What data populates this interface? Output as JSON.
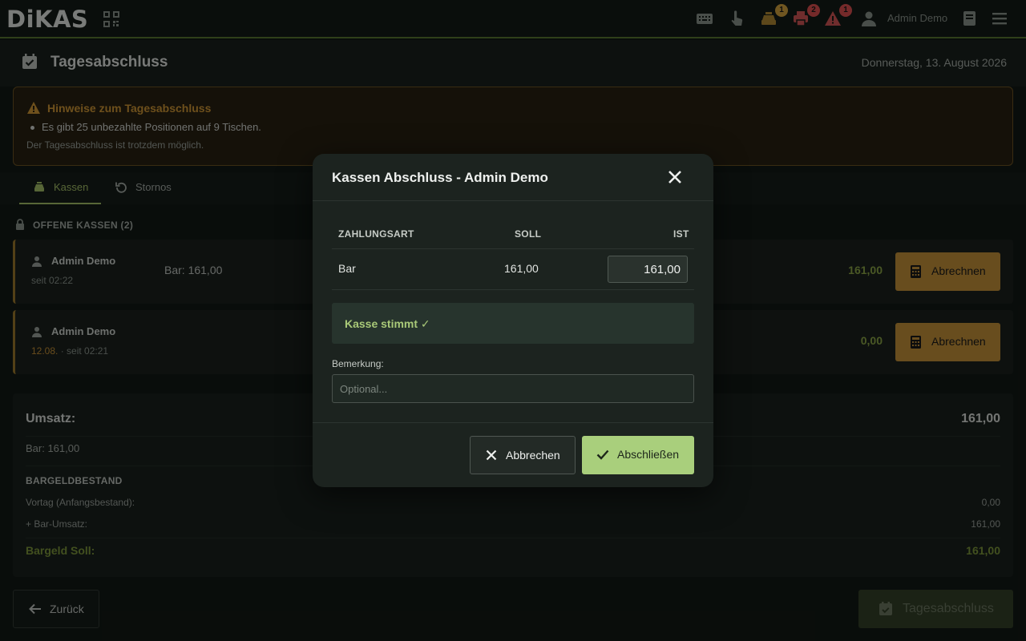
{
  "app": {
    "logo": "DiKAS",
    "user_name": "Admin Demo"
  },
  "topbar_badges": {
    "cash": "1",
    "printer": "2",
    "alert": "1"
  },
  "page": {
    "title": "Tagesabschluss",
    "date": "Donnerstag, 13. August 2026"
  },
  "notice": {
    "title": "Hinweise zum Tagesabschluss",
    "items": [
      "Es gibt 25 unbezahlte Positionen auf 9 Tischen."
    ],
    "subtext": "Der Tagesabschluss ist trotzdem möglich."
  },
  "tabs": [
    {
      "label": "Kassen"
    },
    {
      "label": "Stornos"
    }
  ],
  "section": {
    "open_registers": "OFFENE KASSEN (2)"
  },
  "registers": [
    {
      "name": "Admin Demo",
      "date": "",
      "since": "seit 02:22",
      "bar": "Bar: 161,00",
      "amount": "161,00",
      "button": "Abrechnen"
    },
    {
      "name": "Admin Demo",
      "date": "12.08.",
      "since": " · seit 02:21",
      "bar": "",
      "amount": "0,00",
      "button": "Abrechnen"
    }
  ],
  "summary": {
    "title": "Umsatz:",
    "total": "161,00",
    "bar_line": "Bar: 161,00",
    "cash_heading": "BARGELDBESTAND",
    "rows": [
      {
        "label": "Vortag (Anfangsbestand):",
        "value": "0,00"
      },
      {
        "label": "+ Bar-Umsatz:",
        "value": "161,00"
      }
    ],
    "soll_label": "Bargeld Soll:",
    "soll_value": "161,00"
  },
  "footer": {
    "back": "Zurück",
    "close_day": "Tagesabschluss"
  },
  "modal": {
    "title": "Kassen Abschluss - Admin Demo",
    "columns": [
      "ZAHLUNGSART",
      "SOLL",
      "IST"
    ],
    "row": {
      "method": "Bar",
      "soll": "161,00",
      "ist": "161,00"
    },
    "status": "Kasse stimmt ✓",
    "remark_label": "Bemerkung:",
    "remark_placeholder": "Optional...",
    "cancel": "Abbrechen",
    "confirm": "Abschließen"
  },
  "colors": {
    "accent_green": "#a9cf7c",
    "warning": "#c7943a",
    "alert_red": "#e05252"
  }
}
